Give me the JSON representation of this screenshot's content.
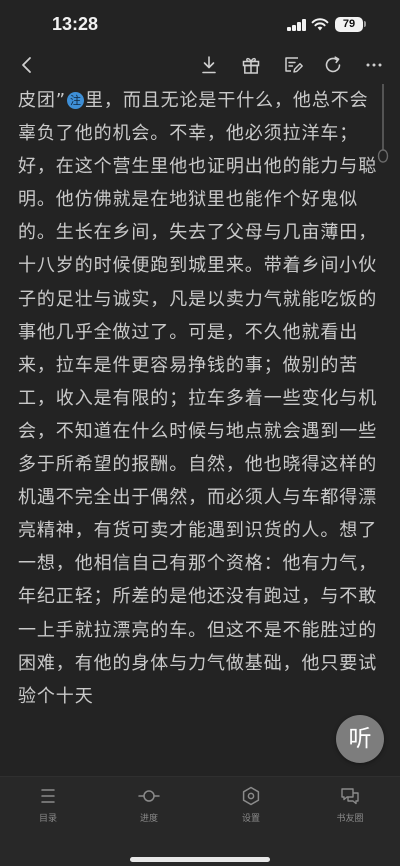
{
  "status_bar": {
    "time": "13:28",
    "battery": "79",
    "icons": [
      "signal-bars-icon",
      "wifi-icon",
      "battery-icon"
    ]
  },
  "toolbar": {
    "icons": [
      "back-chevron-icon",
      "download-icon",
      "gift-icon",
      "note-edit-icon",
      "refresh-icon",
      "more-icon"
    ]
  },
  "content": {
    "text_before_badge": "皮团”",
    "note_badge": "注",
    "text_after_badge": "里，而且无论是干什么，他总不会辜负了他的机会。不幸，他必须拉洋车；好，在这个营生里他也证明出他的能力与聪明。他仿佛就是在地狱里也能作个好鬼似的。生长在乡间，失去了父母与几亩薄田，十八岁的时候便跑到城里来。带着乡间小伙子的足壮与诚实，凡是以卖力气就能吃饭的事他几乎全做过了。可是，不久他就看出来，拉车是件更容易挣钱的事；做别的苦工，收入是有限的；拉车多着一些变化与机会，不知道在什么时候与地点就会遇到一些多于所希望的报酬。自然，他也晓得这样的机遇不完全出于偶然，而必须人与车都得漂亮精神，有货可卖才能遇到识货的人。想了一想，他相信自己有那个资格：他有力气，年纪正轻；所差的是他还没有跑过，与不敢一上手就拉漂亮的车。但这不是不能胜过的困难，有他的身体与力气做基础，他只要试验个十天"
  },
  "listen_button": {
    "label": "听"
  },
  "bottom_nav": {
    "items": [
      {
        "label": "目录",
        "icon": "list-icon"
      },
      {
        "label": "进度",
        "icon": "progress-slider-icon"
      },
      {
        "label": "设置",
        "icon": "settings-hexagon-icon"
      },
      {
        "label": "书友圈",
        "icon": "chat-bubbles-icon"
      }
    ]
  },
  "colors": {
    "background": "#232323",
    "text": "#c9c9c9",
    "badge": "#3e8fd6",
    "listen_button": "#7d7d7d"
  }
}
